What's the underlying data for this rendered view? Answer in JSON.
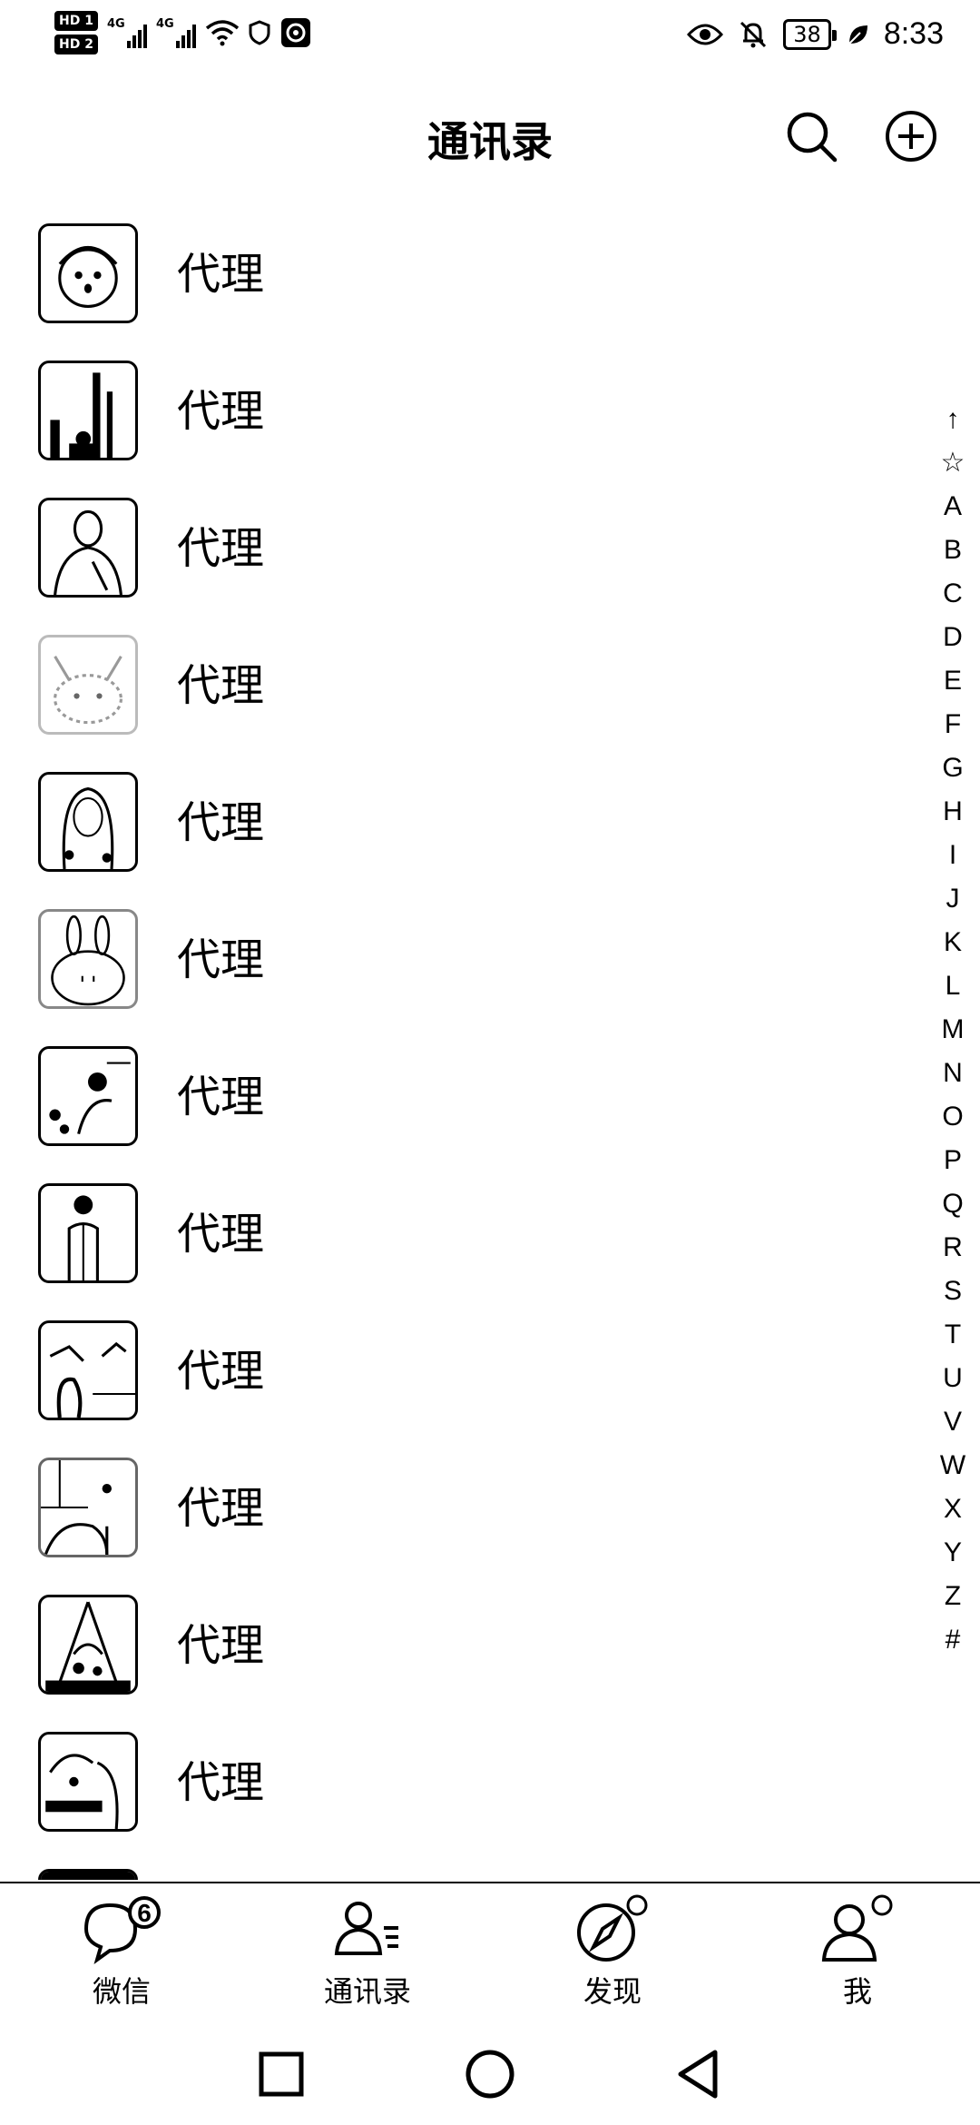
{
  "status_bar": {
    "hd1": "HD 1",
    "hd2": "HD 2",
    "network1": "4G",
    "network2": "4G",
    "battery": "38",
    "time": "8:33"
  },
  "header": {
    "title": "通讯录"
  },
  "contacts": [
    {
      "name": "代理"
    },
    {
      "name": "代理"
    },
    {
      "name": "代理"
    },
    {
      "name": "代理"
    },
    {
      "name": "代理"
    },
    {
      "name": "代理"
    },
    {
      "name": "代理"
    },
    {
      "name": "代理"
    },
    {
      "name": "代理"
    },
    {
      "name": "代理"
    },
    {
      "name": "代理"
    },
    {
      "name": "代理"
    }
  ],
  "index_bar": [
    "↑",
    "☆",
    "A",
    "B",
    "C",
    "D",
    "E",
    "F",
    "G",
    "H",
    "I",
    "J",
    "K",
    "L",
    "M",
    "N",
    "O",
    "P",
    "Q",
    "R",
    "S",
    "T",
    "U",
    "V",
    "W",
    "X",
    "Y",
    "Z",
    "#"
  ],
  "tabs": [
    {
      "label": "微信",
      "icon": "chat-bubble-icon",
      "badge": "6"
    },
    {
      "label": "通讯录",
      "icon": "contacts-icon"
    },
    {
      "label": "发现",
      "icon": "compass-icon"
    },
    {
      "label": "我",
      "icon": "person-icon"
    }
  ],
  "nav": {
    "recents": "square-icon",
    "home": "circle-icon",
    "back": "triangle-back-icon"
  }
}
